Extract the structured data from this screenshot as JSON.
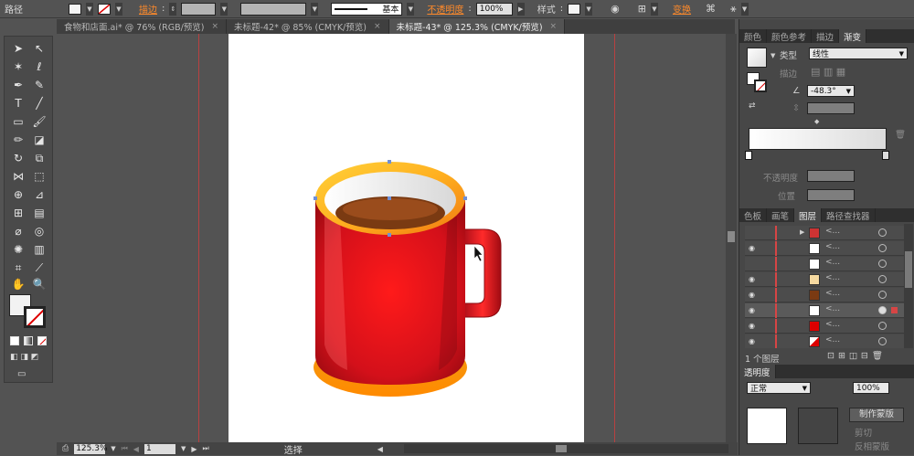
{
  "control_bar": {
    "object_label": "路径",
    "stroke_label": "描边",
    "stroke_colon": ":",
    "brush_label": "基本",
    "opacity_label": "不透明度",
    "opacity_colon": ":",
    "opacity_value": "100%",
    "style_label": "样式",
    "style_colon": ":",
    "transform_label": "变换"
  },
  "tabs": [
    {
      "label": "食物和店面.ai* @ 76% (RGB/预览)",
      "active": false
    },
    {
      "label": "未标题-42* @ 85% (CMYK/预览)",
      "active": false
    },
    {
      "label": "未标题-43* @ 125.3% (CMYK/预览)",
      "active": true
    }
  ],
  "tab_close": "×",
  "status": {
    "zoom": "125.3%",
    "page": "1",
    "tool": "选择"
  },
  "gradient_panel": {
    "tabs": [
      "颜色",
      "颜色参考",
      "描边",
      "渐变"
    ],
    "active_tab": "渐变",
    "type_label": "类型",
    "type_value": "线性",
    "stroke_label": "描边",
    "angle_value": "-48.3°",
    "opacity_label": "不透明度",
    "position_label": "位置"
  },
  "layers_panel": {
    "tabs": [
      "色板",
      "画笔",
      "图层",
      "路径查找器"
    ],
    "active_tab": "图层",
    "row_text": "<...",
    "footer": "1 个图层",
    "colors": {
      "layer": "#d64545"
    }
  },
  "transparency_panel": {
    "tab": "透明度",
    "mode_value": "正常",
    "opacity_value": "100%",
    "button_label": "制作蒙版",
    "clip_label": "剪切",
    "invert_label": "反相蒙版"
  },
  "colors": {
    "mug_red": "#e0121b",
    "rim_orange": "#f39c12",
    "coffee": "#7a3a12",
    "accent_orange": "#ff8a2a"
  }
}
